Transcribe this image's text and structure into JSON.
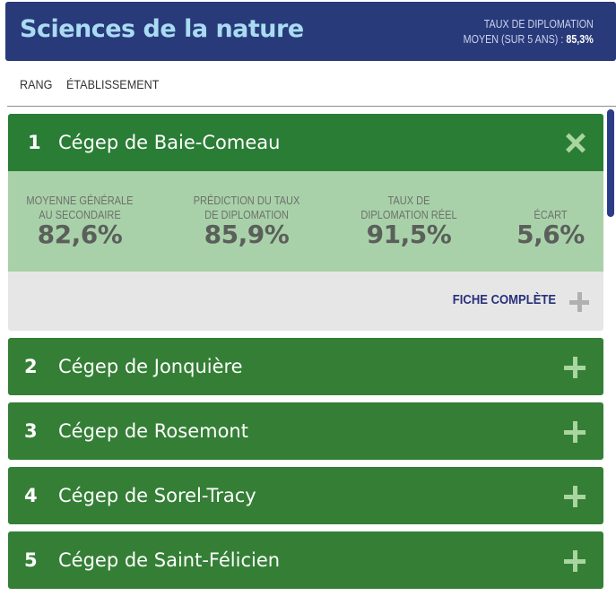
{
  "header": {
    "title": "Sciences de la nature",
    "stat_line1": "TAUX DE DIPLOMATION",
    "stat_line2_prefix": "MOYEN (SUR 5 ANS) :",
    "stat_value": "85,3%"
  },
  "columns": {
    "rank": "RANG",
    "institution": "ÉTABLISSEMENT"
  },
  "expanded": {
    "rank": "1",
    "name": "Cégep de Baie-Comeau",
    "stats": [
      {
        "label_line1": "MOYENNE GÉNÉRALE",
        "label_line2": "AU SECONDAIRE",
        "value": "82,6%"
      },
      {
        "label_line1": "PRÉDICTION DU TAUX",
        "label_line2": "DE DIPLOMATION",
        "value": "85,9%"
      },
      {
        "label_line1": "TAUX DE",
        "label_line2": "DIPLOMATION RÉEL",
        "value": "91,5%"
      },
      {
        "label_line1": "",
        "label_line2": "ÉCART",
        "value": "5,6%"
      }
    ],
    "fiche_label": "FICHE COMPLÈTE"
  },
  "rows": [
    {
      "rank": "2",
      "name": "Cégep de Jonquière"
    },
    {
      "rank": "3",
      "name": "Cégep de Rosemont"
    },
    {
      "rank": "4",
      "name": "Cégep de Sorel-Tracy"
    },
    {
      "rank": "5",
      "name": "Cégep de Saint-Félicien"
    }
  ],
  "colors": {
    "header_bg": "#293a7a",
    "title": "#a9dcf2",
    "row_green": "#347f35",
    "stats_green": "#a9d1a9",
    "fiche_bg": "#e6e6e6",
    "link": "#28307a"
  },
  "icons": {
    "close": "close-icon",
    "expand": "plus-icon"
  }
}
